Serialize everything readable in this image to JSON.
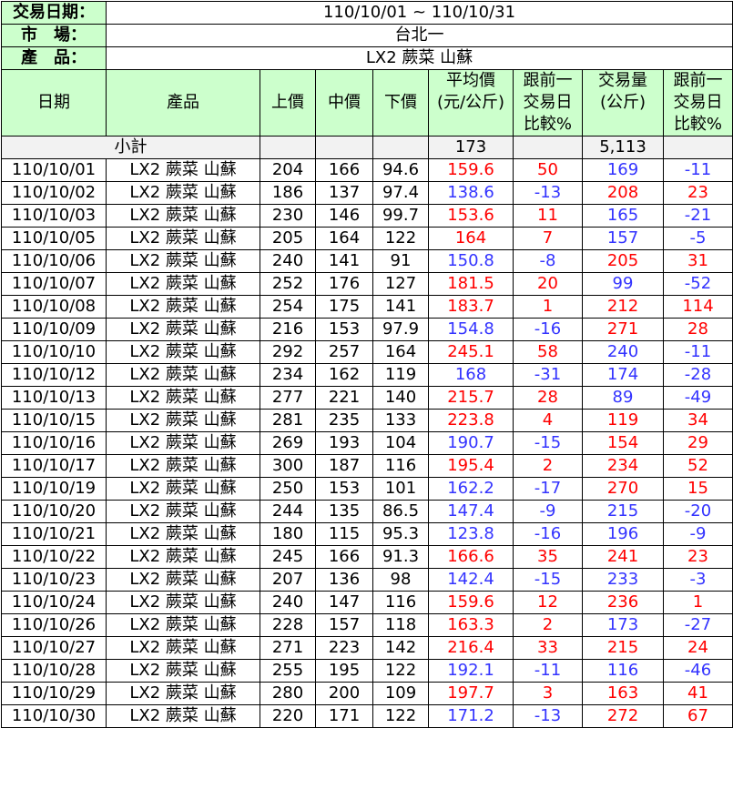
{
  "info": {
    "date_label": "交易日期：",
    "date_value": "110/10/01 ~ 110/10/31",
    "market_label": "市　場：",
    "market_value": "台北一",
    "product_label": "產　品：",
    "product_value": "LX2 蕨菜 山蘇"
  },
  "headers": {
    "date": "日期",
    "product": "產品",
    "upper": "上價",
    "middle": "中價",
    "lower": "下價",
    "avg_line1": "平均價",
    "avg_line2": "(元/公斤)",
    "chg1_line1": "跟前一",
    "chg1_line2": "交易日",
    "chg1_line3": "比較%",
    "vol_line1": "交易量",
    "vol_line2": "(公斤)",
    "chg2_line1": "跟前一",
    "chg2_line2": "交易日",
    "chg2_line3": "比較%"
  },
  "subtotal": {
    "label": "小計",
    "avg": "173",
    "volume": "5,113"
  },
  "colors": {
    "header_bg": "#ccffcc",
    "subtotal_bg": "#f2f2f2",
    "up": "#ff0000",
    "down": "#3333ff"
  },
  "rows": [
    {
      "date": "110/10/01",
      "product": "LX2 蕨菜 山蘇",
      "upper": "204",
      "middle": "166",
      "lower": "94.6",
      "avg": "159.6",
      "avg_dir": "up",
      "avg_chg": "50",
      "avg_chg_dir": "up",
      "vol": "169",
      "vol_dir": "down",
      "vol_chg": "-11",
      "vol_chg_dir": "down"
    },
    {
      "date": "110/10/02",
      "product": "LX2 蕨菜 山蘇",
      "upper": "186",
      "middle": "137",
      "lower": "97.4",
      "avg": "138.6",
      "avg_dir": "down",
      "avg_chg": "-13",
      "avg_chg_dir": "down",
      "vol": "208",
      "vol_dir": "up",
      "vol_chg": "23",
      "vol_chg_dir": "up"
    },
    {
      "date": "110/10/03",
      "product": "LX2 蕨菜 山蘇",
      "upper": "230",
      "middle": "146",
      "lower": "99.7",
      "avg": "153.6",
      "avg_dir": "up",
      "avg_chg": "11",
      "avg_chg_dir": "up",
      "vol": "165",
      "vol_dir": "down",
      "vol_chg": "-21",
      "vol_chg_dir": "down"
    },
    {
      "date": "110/10/05",
      "product": "LX2 蕨菜 山蘇",
      "upper": "205",
      "middle": "164",
      "lower": "122",
      "avg": "164",
      "avg_dir": "up",
      "avg_chg": "7",
      "avg_chg_dir": "up",
      "vol": "157",
      "vol_dir": "down",
      "vol_chg": "-5",
      "vol_chg_dir": "down"
    },
    {
      "date": "110/10/06",
      "product": "LX2 蕨菜 山蘇",
      "upper": "240",
      "middle": "141",
      "lower": "91",
      "avg": "150.8",
      "avg_dir": "down",
      "avg_chg": "-8",
      "avg_chg_dir": "down",
      "vol": "205",
      "vol_dir": "up",
      "vol_chg": "31",
      "vol_chg_dir": "up"
    },
    {
      "date": "110/10/07",
      "product": "LX2 蕨菜 山蘇",
      "upper": "252",
      "middle": "176",
      "lower": "127",
      "avg": "181.5",
      "avg_dir": "up",
      "avg_chg": "20",
      "avg_chg_dir": "up",
      "vol": "99",
      "vol_dir": "down",
      "vol_chg": "-52",
      "vol_chg_dir": "down"
    },
    {
      "date": "110/10/08",
      "product": "LX2 蕨菜 山蘇",
      "upper": "254",
      "middle": "175",
      "lower": "141",
      "avg": "183.7",
      "avg_dir": "up",
      "avg_chg": "1",
      "avg_chg_dir": "up",
      "vol": "212",
      "vol_dir": "up",
      "vol_chg": "114",
      "vol_chg_dir": "up"
    },
    {
      "date": "110/10/09",
      "product": "LX2 蕨菜 山蘇",
      "upper": "216",
      "middle": "153",
      "lower": "97.9",
      "avg": "154.8",
      "avg_dir": "down",
      "avg_chg": "-16",
      "avg_chg_dir": "down",
      "vol": "271",
      "vol_dir": "up",
      "vol_chg": "28",
      "vol_chg_dir": "up"
    },
    {
      "date": "110/10/10",
      "product": "LX2 蕨菜 山蘇",
      "upper": "292",
      "middle": "257",
      "lower": "164",
      "avg": "245.1",
      "avg_dir": "up",
      "avg_chg": "58",
      "avg_chg_dir": "up",
      "vol": "240",
      "vol_dir": "down",
      "vol_chg": "-11",
      "vol_chg_dir": "down"
    },
    {
      "date": "110/10/12",
      "product": "LX2 蕨菜 山蘇",
      "upper": "234",
      "middle": "162",
      "lower": "119",
      "avg": "168",
      "avg_dir": "down",
      "avg_chg": "-31",
      "avg_chg_dir": "down",
      "vol": "174",
      "vol_dir": "down",
      "vol_chg": "-28",
      "vol_chg_dir": "down"
    },
    {
      "date": "110/10/13",
      "product": "LX2 蕨菜 山蘇",
      "upper": "277",
      "middle": "221",
      "lower": "140",
      "avg": "215.7",
      "avg_dir": "up",
      "avg_chg": "28",
      "avg_chg_dir": "up",
      "vol": "89",
      "vol_dir": "down",
      "vol_chg": "-49",
      "vol_chg_dir": "down"
    },
    {
      "date": "110/10/15",
      "product": "LX2 蕨菜 山蘇",
      "upper": "281",
      "middle": "235",
      "lower": "133",
      "avg": "223.8",
      "avg_dir": "up",
      "avg_chg": "4",
      "avg_chg_dir": "up",
      "vol": "119",
      "vol_dir": "up",
      "vol_chg": "34",
      "vol_chg_dir": "up"
    },
    {
      "date": "110/10/16",
      "product": "LX2 蕨菜 山蘇",
      "upper": "269",
      "middle": "193",
      "lower": "104",
      "avg": "190.7",
      "avg_dir": "down",
      "avg_chg": "-15",
      "avg_chg_dir": "down",
      "vol": "154",
      "vol_dir": "up",
      "vol_chg": "29",
      "vol_chg_dir": "up"
    },
    {
      "date": "110/10/17",
      "product": "LX2 蕨菜 山蘇",
      "upper": "300",
      "middle": "187",
      "lower": "116",
      "avg": "195.4",
      "avg_dir": "up",
      "avg_chg": "2",
      "avg_chg_dir": "up",
      "vol": "234",
      "vol_dir": "up",
      "vol_chg": "52",
      "vol_chg_dir": "up"
    },
    {
      "date": "110/10/19",
      "product": "LX2 蕨菜 山蘇",
      "upper": "250",
      "middle": "153",
      "lower": "101",
      "avg": "162.2",
      "avg_dir": "down",
      "avg_chg": "-17",
      "avg_chg_dir": "down",
      "vol": "270",
      "vol_dir": "up",
      "vol_chg": "15",
      "vol_chg_dir": "up"
    },
    {
      "date": "110/10/20",
      "product": "LX2 蕨菜 山蘇",
      "upper": "244",
      "middle": "135",
      "lower": "86.5",
      "avg": "147.4",
      "avg_dir": "down",
      "avg_chg": "-9",
      "avg_chg_dir": "down",
      "vol": "215",
      "vol_dir": "down",
      "vol_chg": "-20",
      "vol_chg_dir": "down"
    },
    {
      "date": "110/10/21",
      "product": "LX2 蕨菜 山蘇",
      "upper": "180",
      "middle": "115",
      "lower": "95.3",
      "avg": "123.8",
      "avg_dir": "down",
      "avg_chg": "-16",
      "avg_chg_dir": "down",
      "vol": "196",
      "vol_dir": "down",
      "vol_chg": "-9",
      "vol_chg_dir": "down"
    },
    {
      "date": "110/10/22",
      "product": "LX2 蕨菜 山蘇",
      "upper": "245",
      "middle": "166",
      "lower": "91.3",
      "avg": "166.6",
      "avg_dir": "up",
      "avg_chg": "35",
      "avg_chg_dir": "up",
      "vol": "241",
      "vol_dir": "up",
      "vol_chg": "23",
      "vol_chg_dir": "up"
    },
    {
      "date": "110/10/23",
      "product": "LX2 蕨菜 山蘇",
      "upper": "207",
      "middle": "136",
      "lower": "98",
      "avg": "142.4",
      "avg_dir": "down",
      "avg_chg": "-15",
      "avg_chg_dir": "down",
      "vol": "233",
      "vol_dir": "down",
      "vol_chg": "-3",
      "vol_chg_dir": "down"
    },
    {
      "date": "110/10/24",
      "product": "LX2 蕨菜 山蘇",
      "upper": "240",
      "middle": "147",
      "lower": "116",
      "avg": "159.6",
      "avg_dir": "up",
      "avg_chg": "12",
      "avg_chg_dir": "up",
      "vol": "236",
      "vol_dir": "up",
      "vol_chg": "1",
      "vol_chg_dir": "up"
    },
    {
      "date": "110/10/26",
      "product": "LX2 蕨菜 山蘇",
      "upper": "228",
      "middle": "157",
      "lower": "118",
      "avg": "163.3",
      "avg_dir": "up",
      "avg_chg": "2",
      "avg_chg_dir": "up",
      "vol": "173",
      "vol_dir": "down",
      "vol_chg": "-27",
      "vol_chg_dir": "down"
    },
    {
      "date": "110/10/27",
      "product": "LX2 蕨菜 山蘇",
      "upper": "271",
      "middle": "223",
      "lower": "142",
      "avg": "216.4",
      "avg_dir": "up",
      "avg_chg": "33",
      "avg_chg_dir": "up",
      "vol": "215",
      "vol_dir": "up",
      "vol_chg": "24",
      "vol_chg_dir": "up"
    },
    {
      "date": "110/10/28",
      "product": "LX2 蕨菜 山蘇",
      "upper": "255",
      "middle": "195",
      "lower": "122",
      "avg": "192.1",
      "avg_dir": "down",
      "avg_chg": "-11",
      "avg_chg_dir": "down",
      "vol": "116",
      "vol_dir": "down",
      "vol_chg": "-46",
      "vol_chg_dir": "down"
    },
    {
      "date": "110/10/29",
      "product": "LX2 蕨菜 山蘇",
      "upper": "280",
      "middle": "200",
      "lower": "109",
      "avg": "197.7",
      "avg_dir": "up",
      "avg_chg": "3",
      "avg_chg_dir": "up",
      "vol": "163",
      "vol_dir": "up",
      "vol_chg": "41",
      "vol_chg_dir": "up"
    },
    {
      "date": "110/10/30",
      "product": "LX2 蕨菜 山蘇",
      "upper": "220",
      "middle": "171",
      "lower": "122",
      "avg": "171.2",
      "avg_dir": "down",
      "avg_chg": "-13",
      "avg_chg_dir": "down",
      "vol": "272",
      "vol_dir": "up",
      "vol_chg": "67",
      "vol_chg_dir": "up"
    }
  ]
}
